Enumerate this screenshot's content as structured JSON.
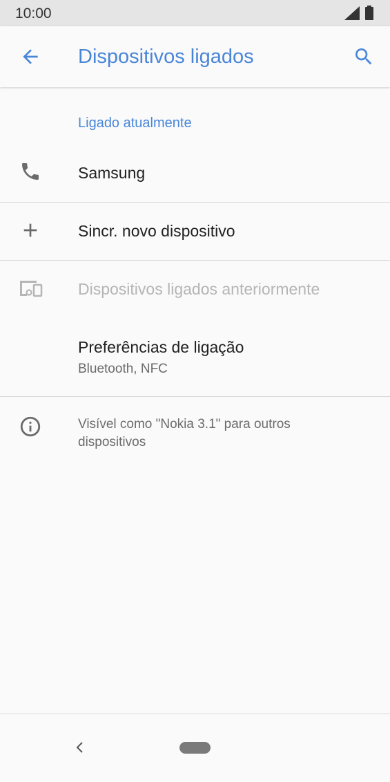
{
  "status_bar": {
    "time": "10:00"
  },
  "app_bar": {
    "title": "Dispositivos ligados"
  },
  "section": {
    "header": "Ligado atualmente"
  },
  "rows": {
    "connected_device": {
      "title": "Samsung"
    },
    "pair_new": {
      "title": "Sincr. novo dispositivo"
    },
    "previously_connected": {
      "title": "Dispositivos ligados anteriormente"
    },
    "connection_prefs": {
      "title": "Preferências de ligação",
      "subtitle": "Bluetooth, NFC"
    }
  },
  "footer": {
    "text": "Visível como \"Nokia 3.1\" para outros dispositivos"
  },
  "colors": {
    "accent": "#4a86d8",
    "icon": "#6b6b6b",
    "disabled": "#b5b5b5"
  },
  "icons": [
    "back-arrow",
    "search",
    "phone",
    "plus",
    "devices",
    "info",
    "nav-back",
    "nav-home"
  ]
}
